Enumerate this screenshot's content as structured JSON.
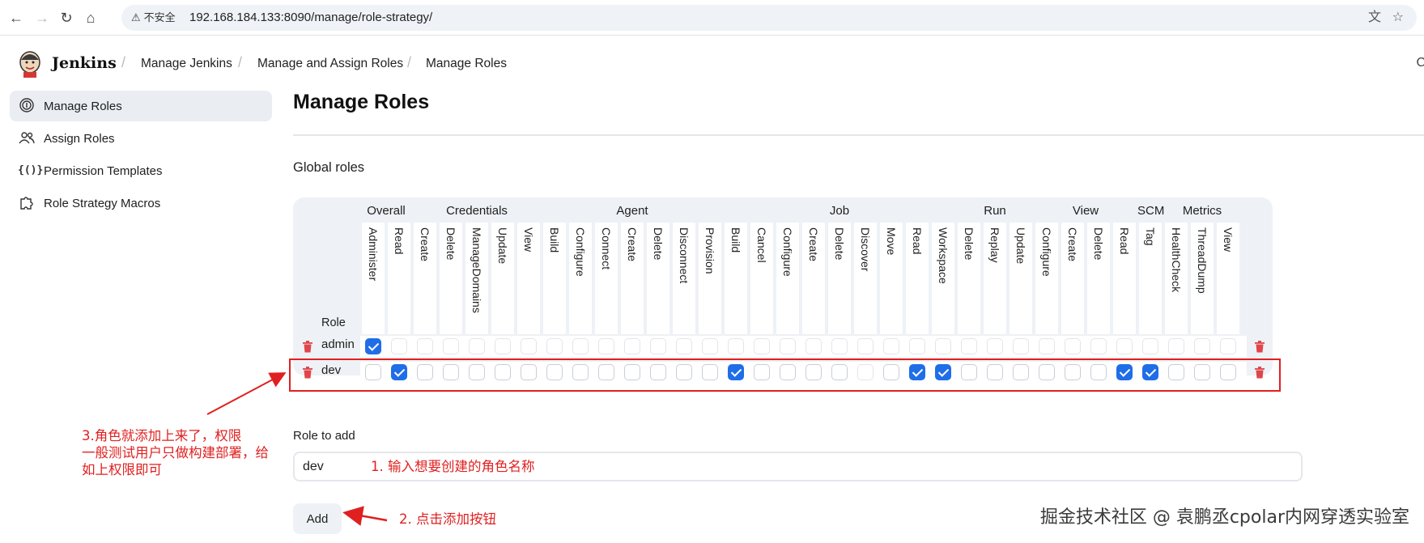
{
  "browser": {
    "security_label": "不安全",
    "url": "192.168.184.133:8090/manage/role-strategy/"
  },
  "header": {
    "brand": "Jenkins",
    "breadcrumbs": [
      "Manage Jenkins",
      "Manage and Assign Roles",
      "Manage Roles"
    ],
    "edge_glyph": "C"
  },
  "sidebar": {
    "items": [
      {
        "label": "Manage Roles",
        "icon": "fingerprint-icon",
        "active": true
      },
      {
        "label": "Assign Roles",
        "icon": "users-icon",
        "active": false
      },
      {
        "label": "Permission Templates",
        "icon": "braces-icon",
        "active": false
      },
      {
        "label": "Role Strategy Macros",
        "icon": "puzzle-icon",
        "active": false
      }
    ]
  },
  "main": {
    "title": "Manage Roles",
    "section_title": "Global roles",
    "table": {
      "role_header": "Role",
      "groups": [
        {
          "name": "Overall",
          "span": 2
        },
        {
          "name": "Credentials",
          "span": 5
        },
        {
          "name": "Agent",
          "span": 7
        },
        {
          "name": "Job",
          "span": 9
        },
        {
          "name": "Run",
          "span": 3
        },
        {
          "name": "View",
          "span": 4
        },
        {
          "name": "SCM",
          "span": 1
        },
        {
          "name": "Metrics",
          "span": 3
        }
      ],
      "permissions": [
        "Administer",
        "Read",
        "Create",
        "Delete",
        "ManageDomains",
        "Update",
        "View",
        "Build",
        "Configure",
        "Connect",
        "Create",
        "Delete",
        "Disconnect",
        "Provision",
        "Build",
        "Cancel",
        "Configure",
        "Create",
        "Delete",
        "Discover",
        "Move",
        "Read",
        "Workspace",
        "Delete",
        "Replay",
        "Update",
        "Configure",
        "Create",
        "Delete",
        "Read",
        "Tag",
        "HealthCheck",
        "ThreadDump",
        "View"
      ],
      "roles": [
        {
          "name": "admin",
          "checked": [
            0
          ],
          "faint_all": true
        },
        {
          "name": "dev",
          "checked": [
            1,
            14,
            21,
            22,
            29,
            30
          ],
          "faint": [
            19
          ]
        }
      ]
    },
    "role_to_add_label": "Role to add",
    "role_input_value": "dev",
    "add_button": "Add"
  },
  "annotations": {
    "step1": "1. 输入想要创建的角色名称",
    "step2": "2. 点击添加按钮",
    "step3": [
      "3.角色就添加上来了，权限",
      "一般测试用户只做构建部署，给",
      "如上权限即可"
    ]
  },
  "watermark": "掘金技术社区 @ 袁鹏丞cpolar内网穿透实验室",
  "colors": {
    "accent": "#1f6ee8",
    "annotation": "#e02020",
    "trash": "#e0454a"
  }
}
